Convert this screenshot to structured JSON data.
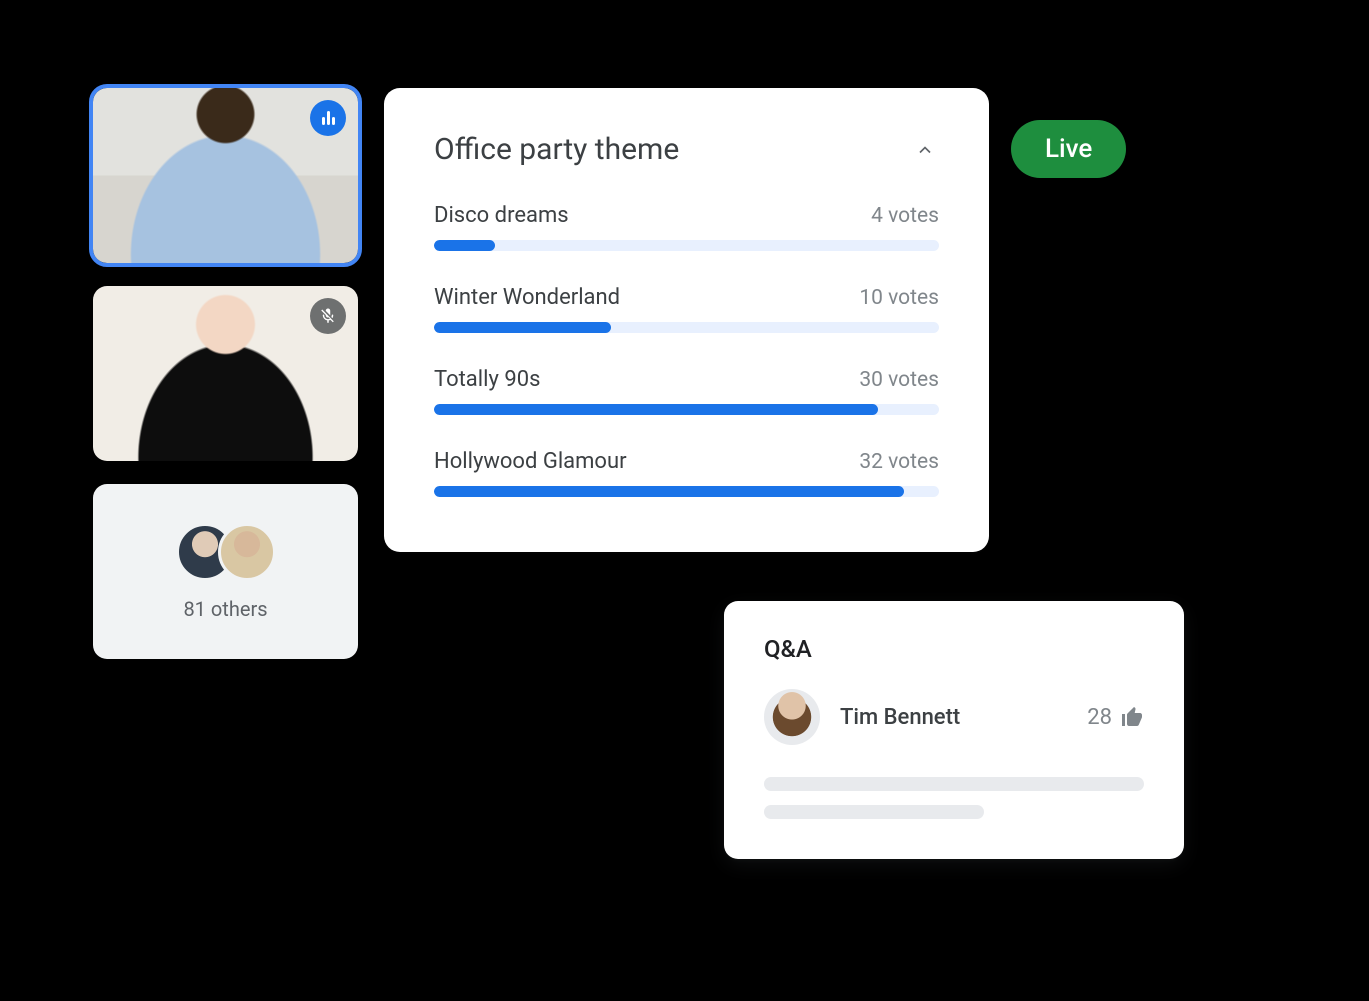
{
  "live": {
    "label": "Live"
  },
  "participants": {
    "others_count": 81,
    "others_label": "81 others"
  },
  "poll": {
    "title": "Office party theme",
    "options": [
      {
        "label": "Disco dreams",
        "votes_text": "4 votes",
        "percent": 12
      },
      {
        "label": "Winter Wonderland",
        "votes_text": "10 votes",
        "percent": 35
      },
      {
        "label": "Totally 90s",
        "votes_text": "30 votes",
        "percent": 88
      },
      {
        "label": "Hollywood Glamour",
        "votes_text": "32 votes",
        "percent": 93
      }
    ]
  },
  "qa": {
    "title": "Q&A",
    "question": {
      "name": "Tim Bennett",
      "likes": 28
    }
  },
  "chart_data": {
    "type": "bar",
    "title": "Office party theme",
    "categories": [
      "Disco dreams",
      "Winter Wonderland",
      "Totally 90s",
      "Hollywood Glamour"
    ],
    "values": [
      4,
      10,
      30,
      32
    ],
    "xlabel": "",
    "ylabel": "votes",
    "ylim": [
      0,
      35
    ]
  }
}
